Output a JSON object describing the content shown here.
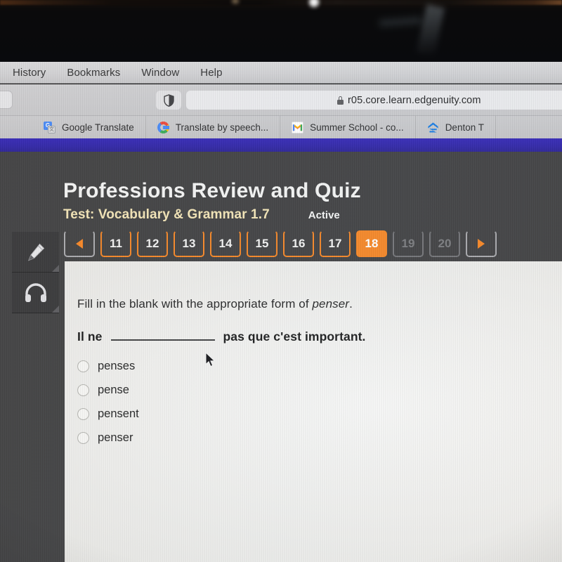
{
  "os_menu": {
    "items": [
      {
        "label": "History"
      },
      {
        "label": "Bookmarks"
      },
      {
        "label": "Window"
      },
      {
        "label": "Help"
      }
    ]
  },
  "browser": {
    "url": "r05.core.learn.edgenuity.com",
    "lock_icon": "lock-icon",
    "shield_icon": "shield-icon",
    "bookmarks": [
      {
        "label": "Google Translate",
        "icon": "google-translate-icon"
      },
      {
        "label": "Translate by speech...",
        "icon": "google-g-icon"
      },
      {
        "label": "Summer School - co...",
        "icon": "gmail-icon"
      },
      {
        "label": "Denton T",
        "icon": "blue-house-icon"
      }
    ]
  },
  "course": {
    "title": "Professions Review and Quiz",
    "subtitle": "Test: Vocabulary & Grammar 1.7",
    "status": "Active"
  },
  "tools": [
    {
      "name": "highlighter-tool",
      "icon": "pencil-icon"
    },
    {
      "name": "audio-tool",
      "icon": "headphones-icon"
    }
  ],
  "pager": {
    "prev_label": "◀",
    "next_label": "▶",
    "current": "18",
    "pages": [
      {
        "label": "11",
        "state": "available"
      },
      {
        "label": "12",
        "state": "available"
      },
      {
        "label": "13",
        "state": "available"
      },
      {
        "label": "14",
        "state": "available"
      },
      {
        "label": "15",
        "state": "available"
      },
      {
        "label": "16",
        "state": "available"
      },
      {
        "label": "17",
        "state": "available"
      },
      {
        "label": "18",
        "state": "current"
      },
      {
        "label": "19",
        "state": "disabled"
      },
      {
        "label": "20",
        "state": "disabled"
      }
    ]
  },
  "question": {
    "prompt_before": "Fill in the blank with the appropriate form of ",
    "prompt_italic": "penser",
    "prompt_after": ".",
    "stem_before": "Il ne",
    "stem_after": "pas que c'est important.",
    "options": [
      {
        "label": "penses",
        "selected": false
      },
      {
        "label": "pense",
        "selected": false
      },
      {
        "label": "pensent",
        "selected": false
      },
      {
        "label": "penser",
        "selected": false
      }
    ]
  },
  "colors": {
    "accent_orange": "#f5821f",
    "app_background": "#3b3b3d",
    "banner_indigo": "#2a1fa4",
    "subtitle_cream": "#f2e3b4"
  },
  "cursor": {
    "icon": "arrow-cursor-icon"
  }
}
